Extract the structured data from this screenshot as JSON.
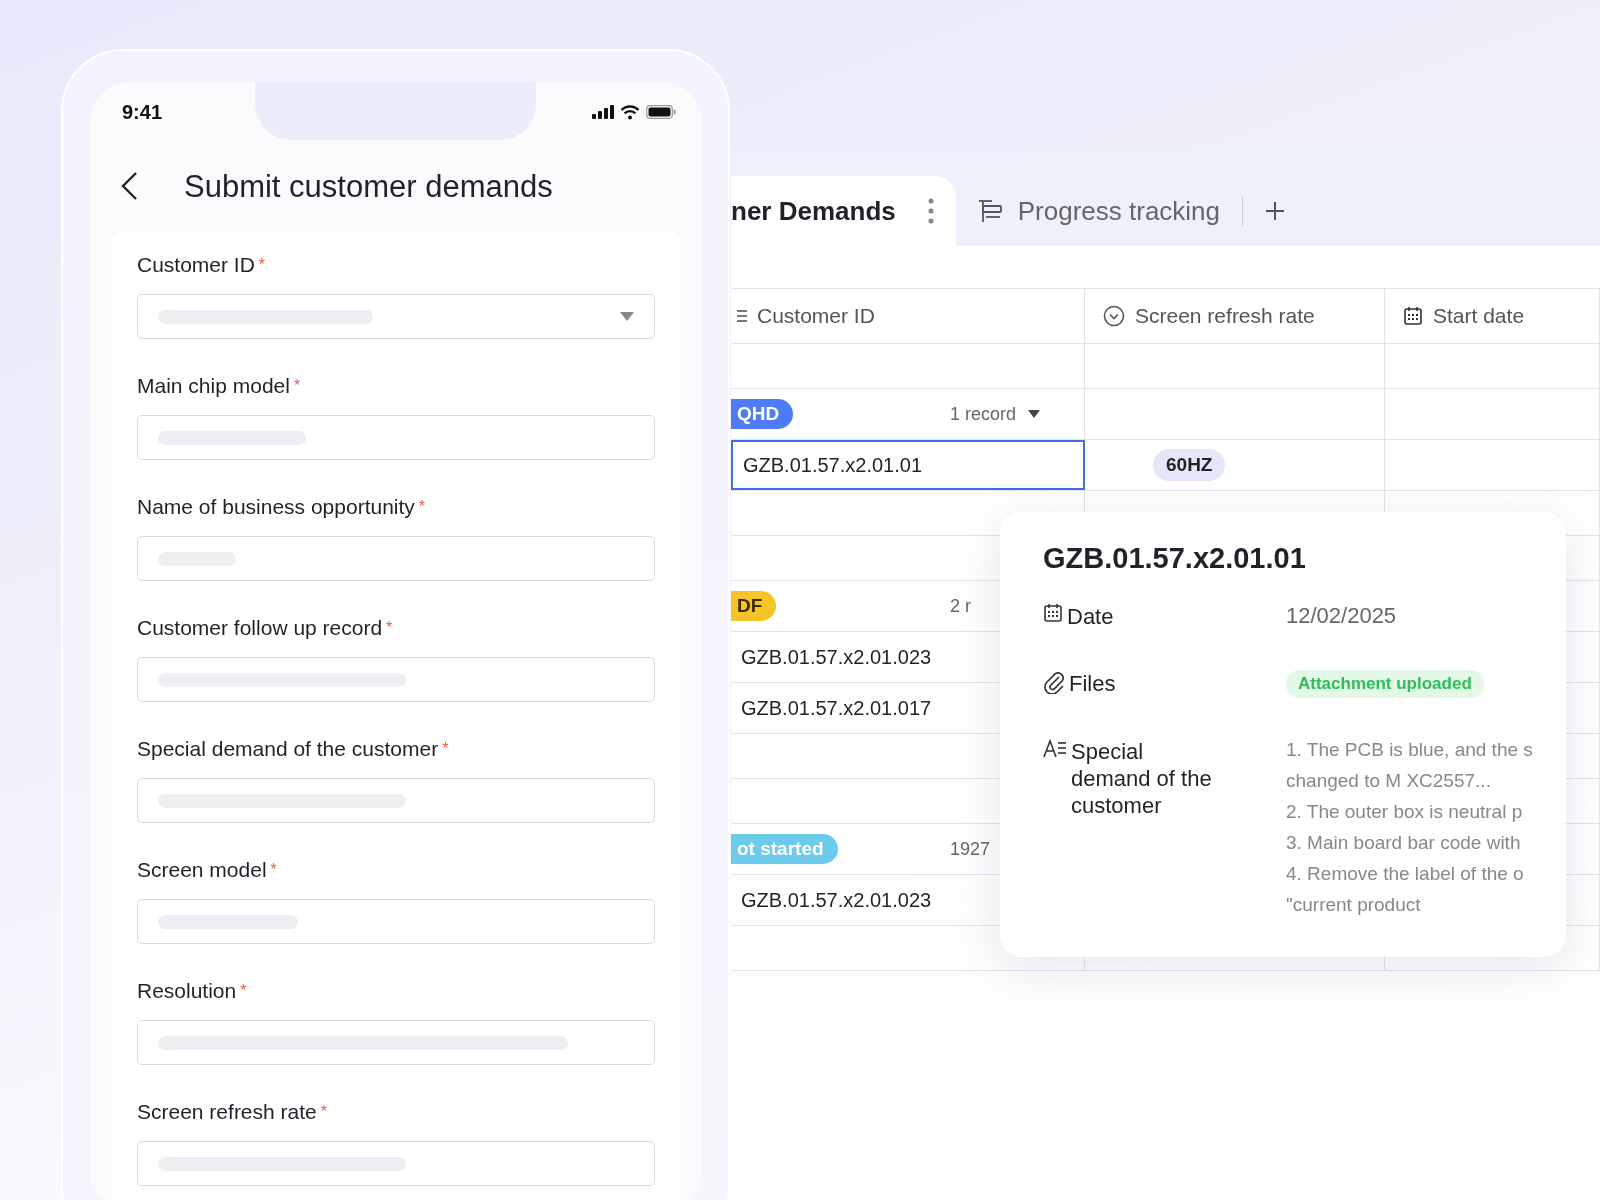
{
  "phone": {
    "status_time": "9:41",
    "title": "Submit customer demands",
    "fields": [
      {
        "kind": "select",
        "label": "Customer ID",
        "asterisk": "*"
      },
      {
        "kind": "text",
        "label": "Main chip model",
        "asterisk": "*"
      },
      {
        "kind": "text",
        "label": "Name of business opportunity",
        "asterisk": "*"
      },
      {
        "kind": "text",
        "label": "Customer follow up record",
        "asterisk": "*"
      },
      {
        "kind": "text",
        "label": "Special demand of the customer",
        "asterisk": "*"
      },
      {
        "kind": "text",
        "label": "Screen model",
        "asterisk": "*"
      },
      {
        "kind": "text",
        "label": "Resolution",
        "asterisk": "*"
      },
      {
        "kind": "text",
        "label": "Screen refresh rate",
        "asterisk": "*"
      }
    ]
  },
  "desktop": {
    "tabs": [
      {
        "label": "ner Demands",
        "selected": true
      },
      {
        "label": "Progress tracking",
        "selected": false
      }
    ],
    "table": {
      "columns": [
        {
          "kind": "text",
          "label": "Customer ID"
        },
        {
          "kind": "select",
          "label": "Screen refresh rate"
        },
        {
          "kind": "date",
          "label": "Start date"
        }
      ],
      "rows": [
        {
          "kind": "empty"
        },
        {
          "kind": "group",
          "tag": "QHD",
          "color": "#4f7cf6",
          "count": "1 record"
        },
        {
          "kind": "record",
          "customer_id": "GZB.01.57.x2.01.01",
          "refresh_rate": "60HZ",
          "selected": true
        },
        {
          "kind": "empty"
        },
        {
          "kind": "empty"
        },
        {
          "kind": "group",
          "tag": "DF",
          "color": "#f6c427",
          "count": "2 r"
        },
        {
          "kind": "record",
          "customer_id": "GZB.01.57.x2.01.023",
          "selected": false
        },
        {
          "kind": "record",
          "customer_id": "GZB.01.57.x2.01.017",
          "selected": false
        },
        {
          "kind": "empty"
        },
        {
          "kind": "empty"
        },
        {
          "kind": "group",
          "tag": "ot started",
          "color": "#6ccbea",
          "count": "1927"
        },
        {
          "kind": "record",
          "customer_id": "GZB.01.57.x2.01.023",
          "selected": false
        },
        {
          "kind": "empty"
        }
      ]
    },
    "popup": {
      "title": "GZB.01.57.x2.01.01",
      "fields": [
        {
          "kind": "date",
          "label": "Date",
          "value": "12/02/2025"
        },
        {
          "kind": "files",
          "label": "Files",
          "value": "Attachment uploaded"
        },
        {
          "kind": "text",
          "label": "Special demand of the customer",
          "lines": [
            "1. The PCB is blue, and the s",
            "changed to M XC2557...",
            "2. The outer box is neutral p",
            "3. Main board bar code with",
            "4. Remove the label of the o",
            "\"current product"
          ]
        }
      ]
    }
  }
}
